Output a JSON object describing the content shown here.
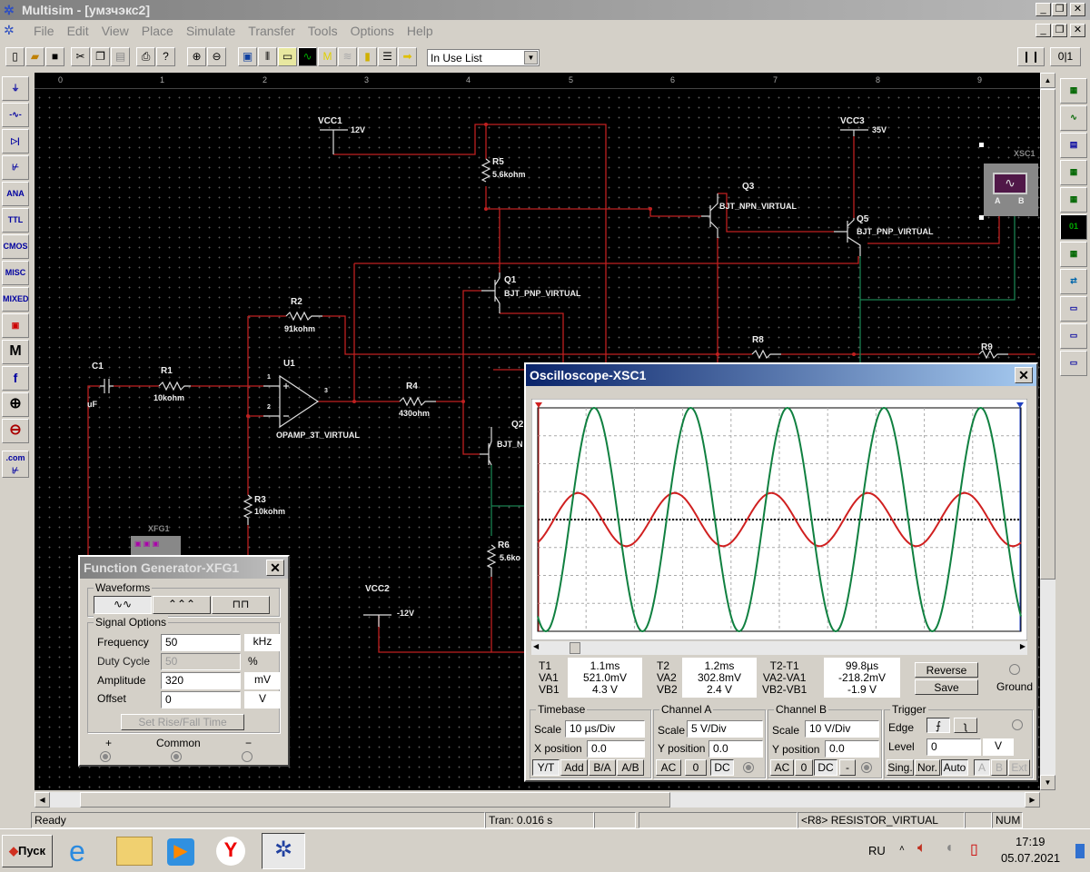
{
  "app": {
    "title": "Multisim - [умзчэкс2]"
  },
  "menu": [
    "File",
    "Edit",
    "View",
    "Place",
    "Simulate",
    "Transfer",
    "Tools",
    "Options",
    "Help"
  ],
  "toolbar": {
    "in_use_list": "In Use List"
  },
  "ruler": [
    "0",
    "1",
    "2",
    "3",
    "4",
    "5",
    "6",
    "7",
    "8",
    "9"
  ],
  "left_toolbar": [
    "sources",
    "basic",
    "diodes",
    "transistors",
    "ANA",
    "TTL",
    "CMOS",
    "MISC",
    "MIXED",
    "indicators",
    "M",
    "f",
    "rf",
    "electromech",
    ".com"
  ],
  "schematic": {
    "vcc1": {
      "name": "VCC1",
      "value": "12V"
    },
    "vcc2": {
      "name": "VCC2",
      "value": "-12V"
    },
    "vcc3": {
      "name": "VCC3",
      "value": "35V"
    },
    "c1": {
      "name": "C1",
      "value": "uF"
    },
    "r1": {
      "name": "R1",
      "value": "10kohm"
    },
    "r2": {
      "name": "R2",
      "value": "91kohm"
    },
    "r3": {
      "name": "R3",
      "value": "10kohm"
    },
    "r4": {
      "name": "R4",
      "value": "430ohm"
    },
    "r5": {
      "name": "R5",
      "value": "5.6kohm"
    },
    "r6": {
      "name": "R6",
      "value": "5.6ko"
    },
    "r8": {
      "name": "R8"
    },
    "r9": {
      "name": "R9"
    },
    "u1": {
      "name": "U1",
      "value": "OPAMP_3T_VIRTUAL",
      "pin1": "1",
      "pin2": "2",
      "pin3": "3"
    },
    "q1": {
      "name": "Q1",
      "value": "BJT_PNP_VIRTUAL"
    },
    "q2": {
      "name": "Q2",
      "value": "BJT_N"
    },
    "q3": {
      "name": "Q3",
      "value": "BJT_NPN_VIRTUAL"
    },
    "q5": {
      "name": "Q5",
      "value": "BJT_PNP_VIRTUAL"
    },
    "xsc1": {
      "name": "XSC1",
      "a": "A",
      "b": "B"
    },
    "xfg1": {
      "name": "XFG1"
    }
  },
  "function_generator": {
    "title": "Function Generator-XFG1",
    "waveforms_label": "Waveforms",
    "selected_waveform": "sine",
    "signal_options_label": "Signal Options",
    "frequency": {
      "label": "Frequency",
      "value": "50",
      "unit": "kHz"
    },
    "duty_cycle": {
      "label": "Duty Cycle",
      "value": "50",
      "unit": "%"
    },
    "amplitude": {
      "label": "Amplitude",
      "value": "320",
      "unit": "mV"
    },
    "offset": {
      "label": "Offset",
      "value": "0",
      "unit": "V"
    },
    "rise_fall_button": "Set Rise/Fall Time",
    "plus": "+",
    "common": "Common",
    "minus": "−"
  },
  "oscilloscope": {
    "title": "Oscilloscope-XSC1",
    "t1": {
      "label": "T1",
      "va": "VA1",
      "vb": "VB1",
      "time": "1.1ms",
      "va_val": "521.0mV",
      "vb_val": "4.3 V"
    },
    "t2": {
      "label": "T2",
      "va": "VA2",
      "vb": "VB2",
      "time": "1.2ms",
      "va_val": "302.8mV",
      "vb_val": "2.4 V"
    },
    "diff": {
      "label": "T2-T1",
      "va": "VA2-VA1",
      "vb": "VB2-VB1",
      "time": "99.8µs",
      "va_val": "-218.2mV",
      "vb_val": "-1.9 V"
    },
    "reverse": "Reverse",
    "save": "Save",
    "ground": "Ground",
    "timebase": {
      "label": "Timebase",
      "scale_label": "Scale",
      "scale": "10 µs/Div",
      "xpos_label": "X position",
      "xpos": "0.0",
      "modes": [
        "Y/T",
        "Add",
        "B/A",
        "A/B"
      ],
      "active_mode": "Y/T"
    },
    "channel_a": {
      "label": "Channel A",
      "scale_label": "Scale",
      "scale": "5 V/Div",
      "ypos_label": "Y position",
      "ypos": "0.0",
      "coupling": [
        "AC",
        "0",
        "DC"
      ],
      "active": "DC",
      "color": "#d02020"
    },
    "channel_b": {
      "label": "Channel B",
      "scale_label": "Scale",
      "scale": "10 V/Div",
      "ypos_label": "Y position",
      "ypos": "0.0",
      "coupling": [
        "AC",
        "0",
        "DC",
        "-"
      ],
      "active": "DC",
      "color": "#108040"
    },
    "trigger": {
      "label": "Trigger",
      "edge_label": "Edge",
      "level_label": "Level",
      "level": "0",
      "level_unit": "V",
      "modes": [
        "Sing.",
        "Nor.",
        "Auto"
      ],
      "active_mode": "Auto",
      "sources": [
        "A",
        "B",
        "Ext"
      ]
    }
  },
  "chart_data": {
    "type": "line",
    "title": "",
    "x_divisions": 10,
    "y_divisions": 8,
    "grid": true,
    "series": [
      {
        "channel": "A",
        "color": "#d02020",
        "frequency_khz": 50,
        "amplitude_div": 0.95,
        "phase_deg": -60
      },
      {
        "channel": "B",
        "color": "#108040",
        "frequency_khz": 50,
        "amplitude_div": 4.0,
        "phase_deg": -120
      }
    ]
  },
  "status": {
    "ready": "Ready",
    "tran": "Tran: 0.016 s",
    "selection": "<R8> RESISTOR_VIRTUAL",
    "num": "NUM"
  },
  "taskbar": {
    "start": "Пуск",
    "lang": "RU",
    "time": "17:19",
    "date": "05.07.2021"
  }
}
